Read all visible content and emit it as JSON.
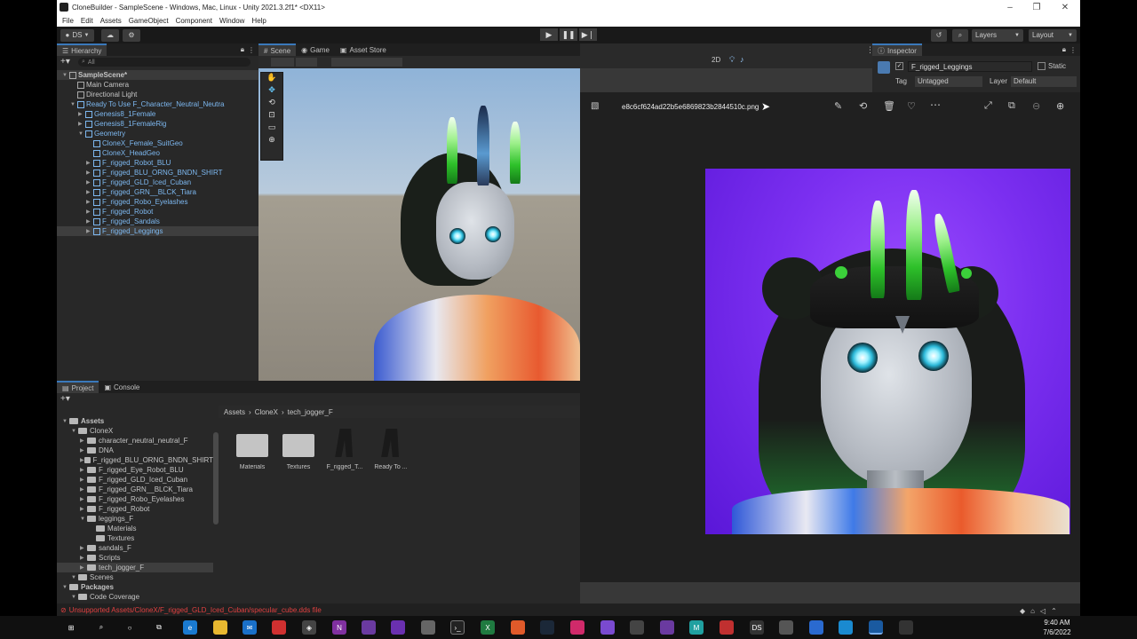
{
  "window": {
    "title": "CloneBuilder - SampleScene - Windows, Mac, Linux - Unity 2021.3.2f1* <DX11>",
    "menu": [
      "File",
      "Edit",
      "Assets",
      "GameObject",
      "Component",
      "Window",
      "Help"
    ]
  },
  "toolbar": {
    "account": "DS",
    "layers": "Layers",
    "layout": "Layout"
  },
  "hierarchy": {
    "tab": "Hierarchy",
    "search_placeholder": "All",
    "rows": [
      {
        "label": "SampleScene*",
        "indent": 0,
        "type": "scene"
      },
      {
        "label": "Main Camera",
        "indent": 1,
        "type": "object"
      },
      {
        "label": "Directional Light",
        "indent": 1,
        "type": "object"
      },
      {
        "label": "Ready To Use F_Character_Neutral_Neutra",
        "indent": 1,
        "type": "prefab"
      },
      {
        "label": "Genesis8_1Female",
        "indent": 2,
        "type": "prefab"
      },
      {
        "label": "Genesis8_1FemaleRig",
        "indent": 2,
        "type": "prefab"
      },
      {
        "label": "Geometry",
        "indent": 2,
        "type": "prefab"
      },
      {
        "label": "CloneX_Female_SuitGeo",
        "indent": 3,
        "type": "prefab"
      },
      {
        "label": "CloneX_HeadGeo",
        "indent": 3,
        "type": "prefab"
      },
      {
        "label": "F_rigged_Robot_BLU",
        "indent": 3,
        "type": "prefab"
      },
      {
        "label": "F_rigged_BLU_ORNG_BNDN_SHIRT",
        "indent": 3,
        "type": "prefab"
      },
      {
        "label": "F_rigged_GLD_Iced_Cuban",
        "indent": 3,
        "type": "prefab"
      },
      {
        "label": "F_rigged_GRN__BLCK_Tiara",
        "indent": 3,
        "type": "prefab"
      },
      {
        "label": "F_rigged_Robo_Eyelashes",
        "indent": 3,
        "type": "prefab"
      },
      {
        "label": "F_rigged_Robot",
        "indent": 3,
        "type": "prefab"
      },
      {
        "label": "F_rigged_Sandals",
        "indent": 3,
        "type": "prefab"
      },
      {
        "label": "F_rigged_Leggings",
        "indent": 3,
        "type": "selected"
      }
    ]
  },
  "scene": {
    "tabs": [
      "Scene",
      "Game",
      "Asset Store"
    ],
    "mode_2d": "2D"
  },
  "inspector": {
    "tab": "Inspector",
    "object_name": "F_rigged_Leggings",
    "static_label": "Static",
    "tag_label": "Tag",
    "tag_value": "Untagged",
    "layer_label": "Layer",
    "layer_value": "Default"
  },
  "viewer": {
    "filename": "e8c6cf624ad22b5e6869823b2844510c.png"
  },
  "project": {
    "tabs": [
      "Project",
      "Console"
    ],
    "breadcrumb": [
      "Assets",
      "CloneX",
      "tech_jogger_F"
    ],
    "tree": [
      {
        "label": "Assets",
        "indent": 0
      },
      {
        "label": "CloneX",
        "indent": 1
      },
      {
        "label": "character_neutral_neutral_F",
        "indent": 2
      },
      {
        "label": "DNA",
        "indent": 2
      },
      {
        "label": "F_rigged_BLU_ORNG_BNDN_SHIRT",
        "indent": 2
      },
      {
        "label": "F_rigged_Eye_Robot_BLU",
        "indent": 2
      },
      {
        "label": "F_rigged_GLD_Iced_Cuban",
        "indent": 2
      },
      {
        "label": "F_rigged_GRN__BLCK_Tiara",
        "indent": 2
      },
      {
        "label": "F_rigged_Robo_Eyelashes",
        "indent": 2
      },
      {
        "label": "F_rigged_Robot",
        "indent": 2
      },
      {
        "label": "leggings_F",
        "indent": 2
      },
      {
        "label": "Materials",
        "indent": 3
      },
      {
        "label": "Textures",
        "indent": 3
      },
      {
        "label": "sandals_F",
        "indent": 2
      },
      {
        "label": "Scripts",
        "indent": 2
      },
      {
        "label": "tech_jogger_F",
        "indent": 2
      },
      {
        "label": "Scenes",
        "indent": 1
      },
      {
        "label": "Packages",
        "indent": 0
      },
      {
        "label": "Code Coverage",
        "indent": 1
      }
    ],
    "assets": [
      {
        "label": "Materials",
        "kind": "folder"
      },
      {
        "label": "Textures",
        "kind": "folder"
      },
      {
        "label": "F_rigged_T...",
        "kind": "model"
      },
      {
        "label": "Ready To ...",
        "kind": "model"
      }
    ]
  },
  "status": {
    "error": "Unsupported Assets/CloneX/F_rigged_GLD_Iced_Cuban/specular_cube.dds file"
  },
  "taskbar": {
    "time": "9:40 AM",
    "date": "7/6/2022"
  },
  "colors": {
    "accent": "#3a79bb",
    "background_purple": "#7b2ff0",
    "spike_green": "#2ec12a"
  }
}
